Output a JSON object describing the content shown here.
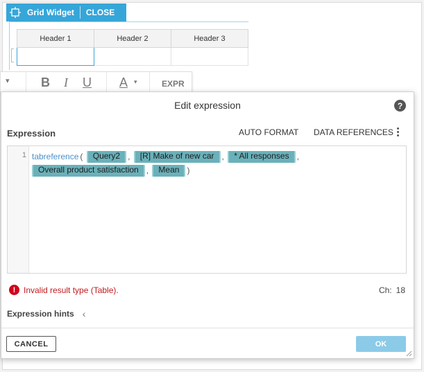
{
  "widget": {
    "title": "Grid Widget",
    "close_label": "CLOSE",
    "headers": [
      "Header 1",
      "Header 2",
      "Header 3"
    ]
  },
  "format_bar": {
    "bold": "B",
    "italic": "I",
    "underline": "U",
    "font_color": "A",
    "expr": "EXPR"
  },
  "dialog": {
    "title": "Edit expression",
    "help_glyph": "?",
    "expression_label": "Expression",
    "auto_format_label": "AUTO FORMAT",
    "data_references_label": "DATA REFERENCES",
    "editor": {
      "line_number": "1",
      "function_name": "tabreference",
      "open_paren": "(",
      "close_paren": ")",
      "comma": ",",
      "tokens": [
        "Query2",
        "[R] Make of new car",
        "* All responses",
        "Overall product satisfaction",
        "Mean"
      ]
    },
    "error_message": "Invalid result type (Table).",
    "char_label": "Ch:",
    "char_count": "18",
    "hints_label": "Expression hints",
    "cancel_label": "CANCEL",
    "ok_label": "OK"
  },
  "colors": {
    "accent": "#36a6d9",
    "token_bg": "#6ab1ba",
    "error": "#d0021b",
    "ok_button": "#8bcbe8"
  }
}
